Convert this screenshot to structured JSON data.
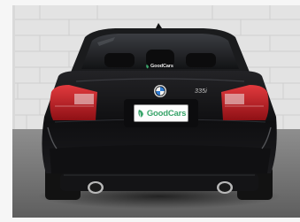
{
  "photo": {
    "subject": "BMW sedan rear view",
    "plate_text": "GoodCars",
    "window_sticker_text": "GoodCars",
    "trunk_badge_text": "335i",
    "colors": {
      "wall": "#e5e5e5",
      "wall_mortar": "#d2d2d2",
      "floor": "#6e6e6e",
      "body": "#141416",
      "taillight": "#b5161c",
      "brand_green": "#3aa56b"
    }
  }
}
